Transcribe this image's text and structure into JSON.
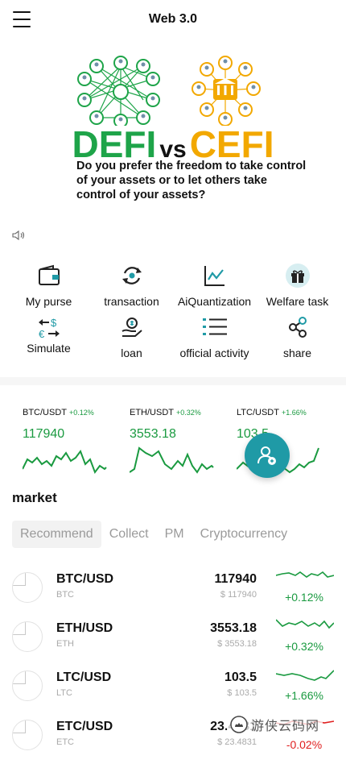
{
  "header": {
    "title": "Web 3.0",
    "menu_icon": "menu-icon"
  },
  "banner": {
    "defi": "DEFI",
    "vs": "vs",
    "cefi": "CEFI",
    "question": "Do you prefer the freedom to take control of your assets or to let others take control of your assets?",
    "colors": {
      "defi": "#1ea449",
      "cefi": "#f2a800"
    }
  },
  "menu": [
    {
      "label": "My purse",
      "icon": "wallet-icon"
    },
    {
      "label": "transaction",
      "icon": "exchange-icon"
    },
    {
      "label": "AiQuantization",
      "icon": "line-chart-icon"
    },
    {
      "label": "Welfare task",
      "icon": "gift-icon"
    },
    {
      "label": "Simulate",
      "icon": "currency-swap-icon"
    },
    {
      "label": "loan",
      "icon": "loan-hand-icon"
    },
    {
      "label": "official activity",
      "icon": "list-icon"
    },
    {
      "label": "share",
      "icon": "share-icon"
    }
  ],
  "tickers": [
    {
      "pair": "BTC/USDT",
      "change": "+0.12%",
      "price": "117940"
    },
    {
      "pair": "ETH/USDT",
      "change": "+0.32%",
      "price": "3553.18"
    },
    {
      "pair": "LTC/USDT",
      "change": "+1.66%",
      "price": "103.5"
    }
  ],
  "market": {
    "title": "market",
    "tabs": [
      "Recommend",
      "Collect",
      "PM",
      "Cryptocurrency"
    ],
    "rows": [
      {
        "symbol": "BTC/USD",
        "base": "BTC",
        "price": "117940",
        "usd": "$ 117940",
        "change": "+0.12%",
        "direction": "up"
      },
      {
        "symbol": "ETH/USD",
        "base": "ETH",
        "price": "3553.18",
        "usd": "$ 3553.18",
        "change": "+0.32%",
        "direction": "up"
      },
      {
        "symbol": "LTC/USD",
        "base": "LTC",
        "price": "103.5",
        "usd": "$ 103.5",
        "change": "+1.66%",
        "direction": "up"
      },
      {
        "symbol": "ETC/USD",
        "base": "ETC",
        "price": "23.4831",
        "usd": "$ 23.4831",
        "change": "-0.02%",
        "direction": "down"
      }
    ]
  },
  "colors": {
    "up": "#1a9a40",
    "down": "#e02020",
    "fab": "#1f9aa6"
  },
  "watermark": {
    "text": "游侠云码网"
  }
}
